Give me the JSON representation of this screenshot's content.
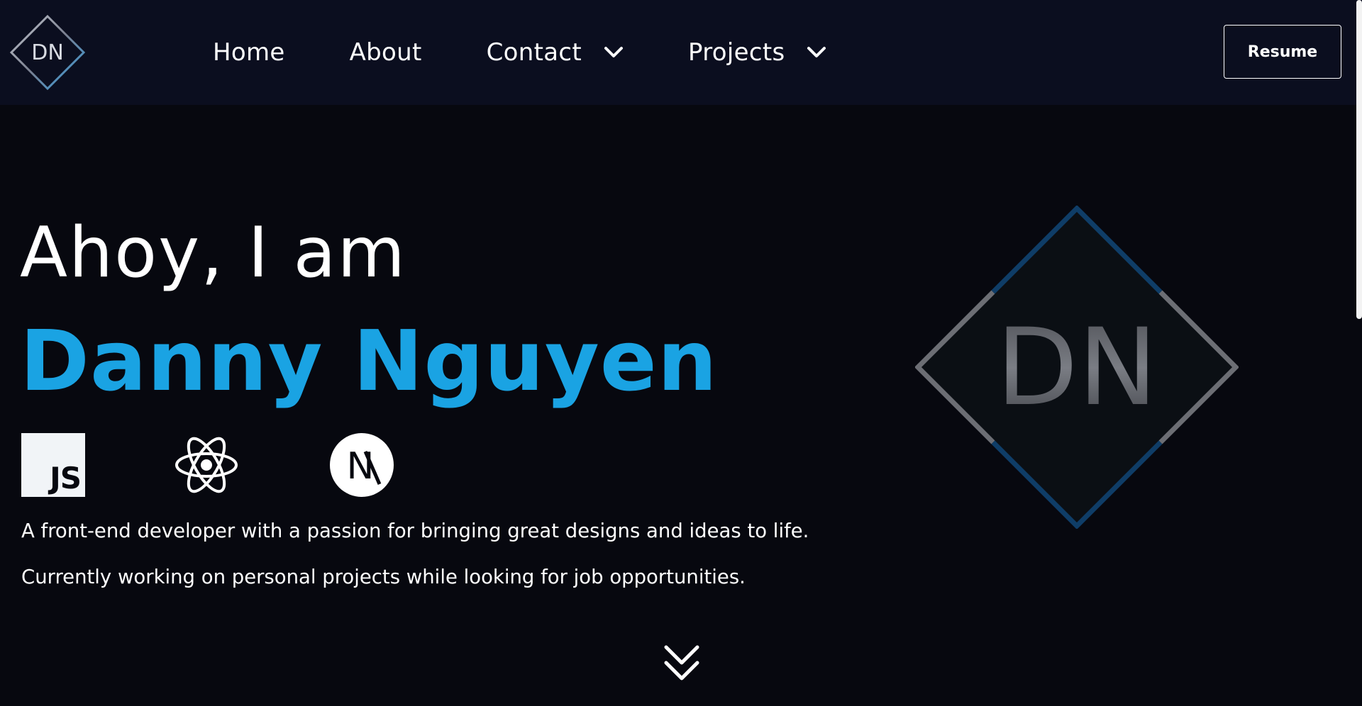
{
  "nav": {
    "logo_text": "DN",
    "links": [
      {
        "label": "Home"
      },
      {
        "label": "About"
      },
      {
        "label": "Contact"
      },
      {
        "label": "Projects"
      }
    ],
    "resume_label": "Resume"
  },
  "hero": {
    "greeting": "Ahoy, I am",
    "name": "Danny Nguyen",
    "logo_text": "DN",
    "tech_icons": [
      {
        "icon": "javascript-icon",
        "text": "JS"
      },
      {
        "icon": "react-icon"
      },
      {
        "icon": "nextjs-icon",
        "text": "N"
      }
    ],
    "tagline": "A front-end developer with a passion for bringing great designs and ideas to life.",
    "status": "Currently working on personal projects while looking for job opportunities."
  },
  "colors": {
    "background": "#07080f",
    "navbar": "#0b0e1f",
    "accent": "#1aa3e3",
    "text": "#ffffff"
  }
}
